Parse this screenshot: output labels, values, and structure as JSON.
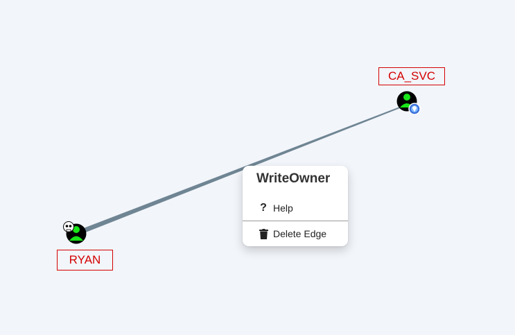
{
  "graph": {
    "nodes": [
      {
        "id": "ca_svc",
        "label": "CA_SVC",
        "badge": "owned-target-icon"
      },
      {
        "id": "ryan",
        "label": "RYAN",
        "badge": "skull-icon"
      }
    ],
    "edge": {
      "source": "RYAN",
      "target": "CA_SVC",
      "type": "WriteOwner"
    }
  },
  "context_menu": {
    "title": "WriteOwner",
    "items": [
      {
        "label": "Help",
        "icon": "question-icon"
      },
      {
        "label": "Delete Edge",
        "icon": "trash-icon"
      }
    ]
  },
  "colors": {
    "background": "#f2f5fa",
    "label_border": "#d40000",
    "edge": "#6f8593",
    "node_fill": "#19e619",
    "node_ring": "#000000"
  }
}
